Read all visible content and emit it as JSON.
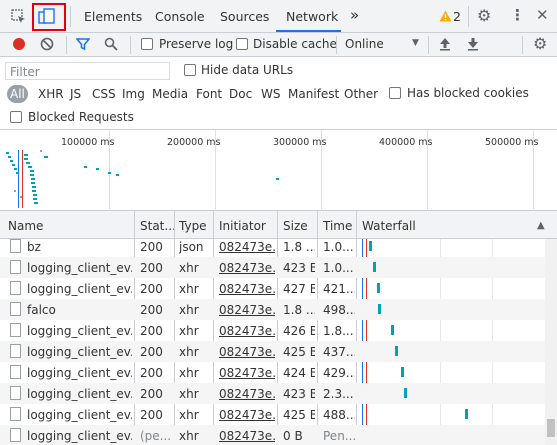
{
  "tabs": {
    "elements": "Elements",
    "console": "Console",
    "sources": "Sources",
    "network": "Network",
    "more": "»",
    "warning_count": "2"
  },
  "toolbar": {
    "preserve_log": "Preserve log",
    "disable_cache": "Disable cache",
    "throttle": "Online"
  },
  "filter": {
    "placeholder": "Filter",
    "hide_data_urls": "Hide data URLs",
    "types": [
      "All",
      "XHR",
      "JS",
      "CSS",
      "Img",
      "Media",
      "Font",
      "Doc",
      "WS",
      "Manifest",
      "Other"
    ],
    "has_blocked_cookies": "Has blocked cookies",
    "blocked_requests": "Blocked Requests"
  },
  "overview": {
    "ticks": [
      "100000 ms",
      "200000 ms",
      "300000 ms",
      "400000 ms",
      "500000 ms"
    ]
  },
  "columns": {
    "name": "Name",
    "status": "Stat...",
    "type": "Type",
    "initiator": "Initiator",
    "size": "Size",
    "time": "Time",
    "waterfall": "Waterfall",
    "sort_icon": "▲"
  },
  "rows": [
    {
      "name": "bz",
      "status": "200",
      "type": "json",
      "initiator": "082473e...",
      "size": "1.8 ...",
      "time": "1.0...",
      "wf": 0.06
    },
    {
      "name": "logging_client_ev...",
      "status": "200",
      "type": "xhr",
      "initiator": "082473e...",
      "size": "423 B",
      "time": "1.0...",
      "wf": 0.08
    },
    {
      "name": "logging_client_ev...",
      "status": "200",
      "type": "xhr",
      "initiator": "082473e...",
      "size": "427 B",
      "time": "421...",
      "wf": 0.1
    },
    {
      "name": "falco",
      "status": "200",
      "type": "xhr",
      "initiator": "082473e...",
      "size": "1.8 ...",
      "time": "498...",
      "wf": 0.11
    },
    {
      "name": "logging_client_ev...",
      "status": "200",
      "type": "xhr",
      "initiator": "082473e...",
      "size": "426 B",
      "time": "1.8...",
      "wf": 0.18
    },
    {
      "name": "logging_client_ev...",
      "status": "200",
      "type": "xhr",
      "initiator": "082473e...",
      "size": "425 B",
      "time": "437...",
      "wf": 0.2
    },
    {
      "name": "logging_client_ev...",
      "status": "200",
      "type": "xhr",
      "initiator": "082473e...",
      "size": "424 B",
      "time": "429...",
      "wf": 0.23
    },
    {
      "name": "logging_client_ev...",
      "status": "200",
      "type": "xhr",
      "initiator": "082473e...",
      "size": "423 B",
      "time": "2.3...",
      "wf": 0.25
    },
    {
      "name": "logging_client_ev...",
      "status": "200",
      "type": "xhr",
      "initiator": "082473e...",
      "size": "425 B",
      "time": "488...",
      "wf": 0.58
    },
    {
      "name": "logging_client_ev...",
      "status": "(pe...",
      "type": "xhr",
      "initiator": "082473e...",
      "size": "0 B",
      "time": "Pen...",
      "wf": null
    }
  ],
  "colors": {
    "accent": "#1a73e8",
    "record": "#d93025",
    "waterfall_bar": "#00a3b4",
    "highlight_box": "#e3000f",
    "warning": "#f9ab00"
  }
}
